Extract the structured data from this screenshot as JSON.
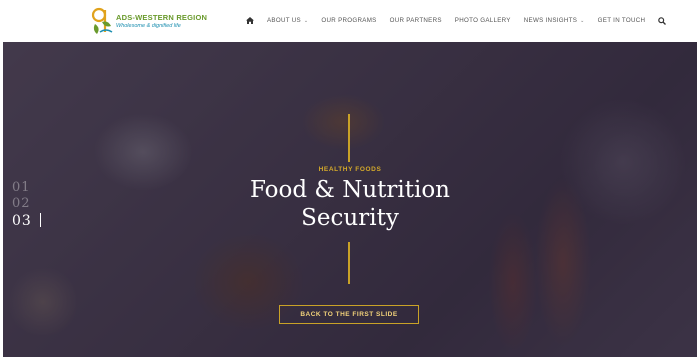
{
  "brand": {
    "title": "ADS-WESTERN REGION",
    "tagline": "Wholesome & dignified life",
    "colors": {
      "green": "#6a9a2c",
      "blue": "#1d8fb0"
    }
  },
  "nav": {
    "home_icon": "home-icon",
    "items": [
      {
        "label": "ABOUT US",
        "dropdown": true
      },
      {
        "label": "OUR PROGRAMS",
        "dropdown": false
      },
      {
        "label": "OUR PARTNERS",
        "dropdown": false
      },
      {
        "label": "PHOTO GALLERY",
        "dropdown": false
      },
      {
        "label": "NEWS INSIGHTS",
        "dropdown": true
      },
      {
        "label": "GET IN TOUCH",
        "dropdown": false
      }
    ],
    "search_icon": "search-icon"
  },
  "hero": {
    "slides": [
      "01",
      "02",
      "03"
    ],
    "active_slide": "03",
    "eyebrow": "HEALTHY FOODS",
    "title_line1": "Food & Nutrition",
    "title_line2": "Security",
    "cta_label": "BACK TO THE FIRST SLIDE",
    "accent_color": "#c9a227"
  }
}
